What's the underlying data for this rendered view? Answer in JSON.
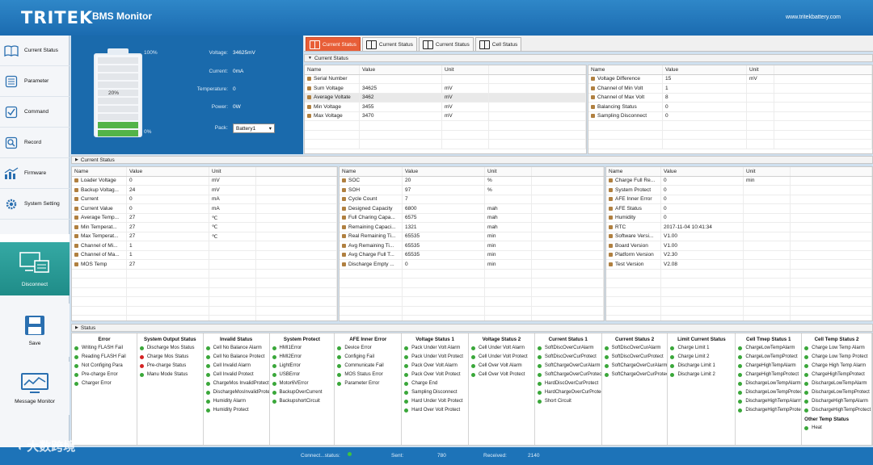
{
  "app": {
    "logo": "TRITEK",
    "title": "BMS Monitor",
    "url": "www.tritekbattery.com"
  },
  "sidebar": {
    "items": [
      {
        "label": "Current Status",
        "icon": "book-icon"
      },
      {
        "label": "Parameter",
        "icon": "list-icon"
      },
      {
        "label": "Command",
        "icon": "checkbox-icon"
      },
      {
        "label": "Record",
        "icon": "search-icon"
      },
      {
        "label": "Firmware",
        "icon": "chart-icon"
      },
      {
        "label": "System Setting",
        "icon": "gear-icon"
      }
    ],
    "disconnect_label": "Disconnect",
    "save_label": "Save",
    "message_label": "Message Monitor"
  },
  "battery": {
    "top_pct": "100%",
    "level_label": "20%",
    "bottom_pct": "0%",
    "level_fraction": 0.2,
    "voltage_label": "Voltage:",
    "voltage": "34625mV",
    "current_label": "Current:",
    "current": "0mA",
    "temperature_label": "Temperature:",
    "temperature": "0",
    "power_label": "Power:",
    "power": "0W",
    "pack_label": "Pack:",
    "pack": "Battery1"
  },
  "tabs": [
    "Current Status",
    "Current Status",
    "Current Status",
    "Cell Status"
  ],
  "top_section": {
    "title": "Current Status",
    "left": {
      "headers": [
        "Name",
        "Value",
        "Unit"
      ],
      "rows": [
        [
          "Serial Number",
          "",
          ""
        ],
        [
          "Sum Voltage",
          "34625",
          "mV"
        ],
        [
          "Average Voltate",
          "3462",
          "mV"
        ],
        [
          "Min Voltage",
          "3455",
          "mV"
        ],
        [
          "Max Voltage",
          "3470",
          "mV"
        ]
      ]
    },
    "right": {
      "headers": [
        "Name",
        "Value",
        "Unit"
      ],
      "rows": [
        [
          "Voltage Difference",
          "15",
          "mV"
        ],
        [
          "Channel of Min Volt",
          "1",
          ""
        ],
        [
          "Channel of Max Volt",
          "8",
          ""
        ],
        [
          "Balancing Status",
          "0",
          ""
        ],
        [
          "Sampling Disconnect",
          "0",
          ""
        ]
      ]
    }
  },
  "middle_section": {
    "title": "Current Status",
    "col1": {
      "headers": [
        "Name",
        "Value",
        "Unit"
      ],
      "rows": [
        [
          "Loader Voltage",
          "0",
          "mV"
        ],
        [
          "Backup Voltag...",
          "24",
          "mV"
        ],
        [
          "Current",
          "0",
          "mA"
        ],
        [
          "Current Value",
          "0",
          "mA"
        ],
        [
          "Average Temp...",
          "27",
          "℃"
        ],
        [
          "Min Temperat...",
          "27",
          "℃"
        ],
        [
          "Max Temperat...",
          "27",
          "℃"
        ],
        [
          "Channel of Mi...",
          "1",
          ""
        ],
        [
          "Channel of Ma...",
          "1",
          ""
        ],
        [
          "MOS Temp",
          "27",
          ""
        ]
      ]
    },
    "col2": {
      "headers": [
        "Name",
        "Value",
        "Unit"
      ],
      "rows": [
        [
          "SOC",
          "20",
          "%"
        ],
        [
          "SOH",
          "97",
          "%"
        ],
        [
          "Cycle Count",
          "7",
          ""
        ],
        [
          "Designed Capacity",
          "6800",
          "mah"
        ],
        [
          "Full Charing Capa...",
          "6575",
          "mah"
        ],
        [
          "Remaining Capaci...",
          "1321",
          "mah"
        ],
        [
          "Real Remaining Ti...",
          "65535",
          "min"
        ],
        [
          "Avg Remaining Ti...",
          "65535",
          "min"
        ],
        [
          "Avg Charge Full T...",
          "65535",
          "min"
        ],
        [
          "Discharge Empty ...",
          "0",
          "min"
        ]
      ]
    },
    "col3": {
      "headers": [
        "Name",
        "Value",
        "Unit"
      ],
      "rows": [
        [
          "Charge Full Re...",
          "0",
          "min"
        ],
        [
          "System Protect",
          "0",
          ""
        ],
        [
          "AFE Inner Error",
          "0",
          ""
        ],
        [
          "AFE Status",
          "0",
          ""
        ],
        [
          "Humidity",
          "0",
          ""
        ],
        [
          "RTC",
          "2017-11-04 10:41:34",
          ""
        ],
        [
          "Software Versi...",
          "V1.00",
          ""
        ],
        [
          "Board Version",
          "V1.00",
          ""
        ],
        [
          "Platform Version",
          "V2.30",
          ""
        ],
        [
          "Test Version",
          "V2.08",
          ""
        ]
      ]
    }
  },
  "status_section": {
    "title": "Status",
    "columns": [
      {
        "title": "Error",
        "items": [
          {
            "label": "Writing FLASH Fail",
            "state": "green"
          },
          {
            "label": "Reading FLASH Fail",
            "state": "green"
          },
          {
            "label": "Not Configing Para",
            "state": "green"
          },
          {
            "label": "Pre-charge Error",
            "state": "green"
          },
          {
            "label": "Charger Error",
            "state": "green"
          }
        ]
      },
      {
        "title": "System Output Status",
        "items": [
          {
            "label": "Discharge Mos Status",
            "state": "green"
          },
          {
            "label": "Charge Mos Status",
            "state": "red"
          },
          {
            "label": "Pre-charge Status",
            "state": "red"
          },
          {
            "label": "Manu Mode Status",
            "state": "green"
          }
        ]
      },
      {
        "title": "Invalid Status",
        "items": [
          {
            "label": "Cell No Balance Alarm",
            "state": "green"
          },
          {
            "label": "Cell No Balance Protect",
            "state": "green"
          },
          {
            "label": "Cell Invalid Alarm",
            "state": "green"
          },
          {
            "label": "Cell Invalid Protect",
            "state": "green"
          },
          {
            "label": "ChargeMos InvalidProtect",
            "state": "green"
          },
          {
            "label": "DischargeMosInvalidProtect",
            "state": "green"
          },
          {
            "label": "Humidity Alarm",
            "state": "green"
          },
          {
            "label": "Humidity Protect",
            "state": "green"
          }
        ]
      },
      {
        "title": "System Protect",
        "items": [
          {
            "label": "HMI1Error",
            "state": "green"
          },
          {
            "label": "HMI2Error",
            "state": "green"
          },
          {
            "label": "LightError",
            "state": "green"
          },
          {
            "label": "USBError",
            "state": "green"
          },
          {
            "label": "Motor6VError",
            "state": "green"
          },
          {
            "label": "BackupOverCurrent",
            "state": "green"
          },
          {
            "label": "BackupshortCircuit",
            "state": "green"
          }
        ]
      },
      {
        "title": "AFE Inner Error",
        "items": [
          {
            "label": "Device Error",
            "state": "green"
          },
          {
            "label": "Configing Fail",
            "state": "green"
          },
          {
            "label": "Communicate Fail",
            "state": "green"
          },
          {
            "label": "MOS Status Error",
            "state": "green"
          },
          {
            "label": "Parameter Error",
            "state": "green"
          }
        ]
      },
      {
        "title": "Voltage Status 1",
        "items": [
          {
            "label": "Pack Under Volt Alarm",
            "state": "green"
          },
          {
            "label": "Pack Under Volt Protect",
            "state": "green"
          },
          {
            "label": "Pack Over Volt Alarm",
            "state": "green"
          },
          {
            "label": "Pack Over Volt Protect",
            "state": "green"
          },
          {
            "label": "Charge End",
            "state": "green"
          },
          {
            "label": "Sampling Disconnect",
            "state": "green"
          },
          {
            "label": "Hard Under Volt Protect",
            "state": "green"
          },
          {
            "label": "Hard Over Volt Protect",
            "state": "green"
          }
        ]
      },
      {
        "title": "Voltage Status 2",
        "items": [
          {
            "label": "Cell Under Volt Alarm",
            "state": "green"
          },
          {
            "label": "Cell Under Volt Protect",
            "state": "green"
          },
          {
            "label": "Cell Over Volt Alarm",
            "state": "green"
          },
          {
            "label": "Cell Over Volt Protect",
            "state": "green"
          }
        ]
      },
      {
        "title": "Current Status 1",
        "items": [
          {
            "label": "SoftDiscOverCurAlarm",
            "state": "green"
          },
          {
            "label": "SoftDiscOverCurProtect",
            "state": "green"
          },
          {
            "label": "SoftChargeOverCurAlarm",
            "state": "green"
          },
          {
            "label": "SoftChargeOverCurProtect",
            "state": "green"
          },
          {
            "label": "HardDiscOverCurProtect",
            "state": "green"
          },
          {
            "label": "HardChargeOverCurProtect",
            "state": "green"
          },
          {
            "label": "Short Circuit",
            "state": "green"
          }
        ]
      },
      {
        "title": "Current Status 2",
        "items": [
          {
            "label": "SoftDiscOverCurAlarm",
            "state": "green"
          },
          {
            "label": "SoftDiscOverCurProtect",
            "state": "green"
          },
          {
            "label": "SoftChargeOverCurAlarm",
            "state": "green"
          },
          {
            "label": "SoftChargeOverCurProtect",
            "state": "green"
          }
        ]
      },
      {
        "title": "Limit Current Status",
        "items": [
          {
            "label": "Charge Limit 1",
            "state": "green"
          },
          {
            "label": "Charge Limit 2",
            "state": "green"
          },
          {
            "label": "Discharge Limit 1",
            "state": "green"
          },
          {
            "label": "Discharge Limit 2",
            "state": "green"
          }
        ]
      },
      {
        "title": "Cell Tmep Status 1",
        "items": [
          {
            "label": "ChargeLowTempAlarm",
            "state": "green"
          },
          {
            "label": "ChargeLowTempProtect",
            "state": "green"
          },
          {
            "label": "ChargeHighTempAlarm",
            "state": "green"
          },
          {
            "label": "ChargeHighTempProtect",
            "state": "green"
          },
          {
            "label": "DischargeLowTempAlarm",
            "state": "green"
          },
          {
            "label": "DischargeLowTempProtect",
            "state": "green"
          },
          {
            "label": "DischargeHighTempAlarm",
            "state": "green"
          },
          {
            "label": "DischargeHighTempProtect",
            "state": "green"
          }
        ]
      },
      {
        "title": "Cell Temp Status 2",
        "items": [
          {
            "label": "Charge Low Temp Alarm",
            "state": "green"
          },
          {
            "label": "Charge Low Temp Protect",
            "state": "green"
          },
          {
            "label": "Charge High Temp Alarm",
            "state": "green"
          },
          {
            "label": "ChargeHighTempProtect",
            "state": "green"
          },
          {
            "label": "DischargeLowTempAlarm",
            "state": "green"
          },
          {
            "label": "DischargeLowTempProtect",
            "state": "green"
          },
          {
            "label": "DischargeHighTempAlarm",
            "state": "green"
          },
          {
            "label": "DischargeHighTempProtect",
            "state": "green"
          }
        ],
        "sub_title": "Other Temp Status",
        "sub_items": [
          {
            "label": "Heat",
            "state": "green"
          }
        ]
      }
    ]
  },
  "status_bar": {
    "connect_label": "Connect...status:",
    "sent_label": "Sent:",
    "sent": "780",
    "received_label": "Received:",
    "received": "2140"
  },
  "watermark": "大数跨境",
  "colors": {
    "header": "#1b6bb0",
    "active_tab": "#e85e37",
    "ok": "#3aa73a",
    "alarm": "#d42424",
    "disconnect": "#26948f"
  }
}
